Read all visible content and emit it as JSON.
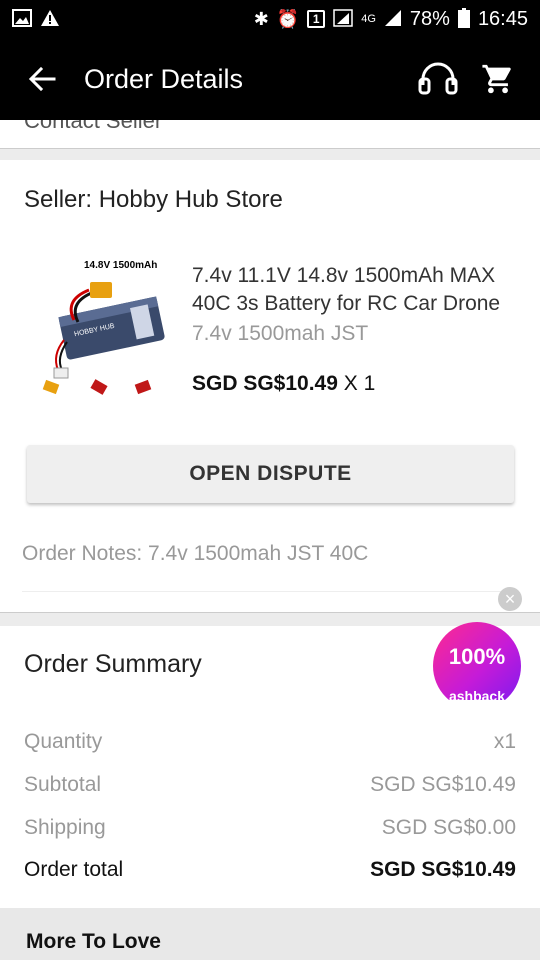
{
  "status_bar": {
    "battery": "78%",
    "time": "16:45",
    "network": "4G",
    "sim_badge": "1"
  },
  "app_bar": {
    "title": "Order Details",
    "back_icon": "arrow-left-icon",
    "support_icon": "headset-icon",
    "cart_icon": "cart-icon"
  },
  "partial_above": "Contact Seller",
  "seller": {
    "name": "Seller: Hobby Hub Store",
    "product": {
      "image_label": "14.8V 1500mAh",
      "title": "7.4v 11.1V 14.8v 1500mAh MAX 40C 3s Battery for RC Car Drone",
      "variant": "7.4v 1500mah  JST",
      "price": "SGD SG$10.49",
      "qty": " X 1"
    },
    "dispute_button": "OPEN DISPUTE",
    "order_notes": "Order Notes: 7.4v 1500mah JST 40C"
  },
  "cashback": {
    "percent": "100%",
    "label": "ashback"
  },
  "summary": {
    "title": "Order Summary",
    "rows": [
      {
        "label": "Quantity",
        "value": "x1"
      },
      {
        "label": "Subtotal",
        "value": "SGD SG$10.49"
      },
      {
        "label": "Shipping",
        "value": "SGD SG$0.00"
      },
      {
        "label": "Order total",
        "value": "SGD SG$10.49"
      }
    ]
  },
  "more": {
    "title": "More To Love"
  },
  "colors": {
    "app_bar_bg": "#000000",
    "cashback_gradient_start": "#ff2a8f",
    "cashback_gradient_end": "#7a1bf0"
  }
}
